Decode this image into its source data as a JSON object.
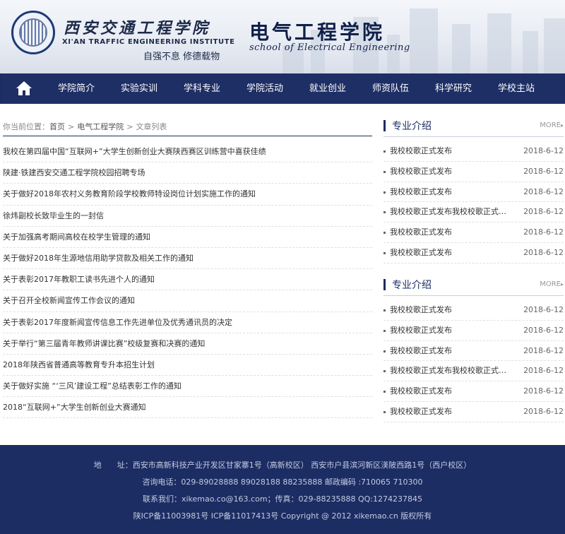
{
  "header": {
    "school_cn": "西安交通工程学院",
    "school_en": "XI'AN TRAFFIC ENGINEERING INSTITUTE",
    "motto": "自强不息 修德载物",
    "college_cn": "电气工程学院",
    "college_en": "school of Electrical Engineering"
  },
  "nav": {
    "home_icon": "home-icon",
    "items": [
      "学院简介",
      "实验实训",
      "学科专业",
      "学院活动",
      "就业创业",
      "师资队伍",
      "科学研究",
      "学校主站"
    ]
  },
  "breadcrumb": {
    "prefix": "你当前位置：",
    "items": [
      "首页",
      "电气工程学院",
      "文章列表"
    ],
    "sep": ">"
  },
  "articles": [
    "我校在第四届中国“互联网+”大学生创新创业大赛陕西赛区训练营中喜获佳绩",
    "陕建·铁建西安交通工程学院校园招聘专场",
    "关于做好2018年农村义务教育阶段学校教师特设岗位计划实施工作的通知",
    "徐炜副校长致毕业生的一封信",
    "关于加强高考期间高校在校学生管理的通知",
    "关于做好2018年生源地信用助学贷款及相关工作的通知",
    "关于表彰2017年教职工读书先进个人的通知",
    "关于召开全校新闻宣传工作会议的通知",
    "关于表彰2017年度新闻宣传信息工作先进单位及优秀通讯员的决定",
    "关于举行“第三届青年教师讲课比赛”校级复赛和决赛的通知",
    "2018年陕西省普通高等教育专升本招生计划",
    "关于做好实施 “‘三风’建设工程”总结表彰工作的通知",
    "2018“互联网+”大学生创新创业大赛通知"
  ],
  "sidebar": [
    {
      "title": "专业介绍",
      "more": "MORE",
      "items": [
        {
          "title": "我校校歌正式发布",
          "date": "2018-6-12"
        },
        {
          "title": "我校校歌正式发布",
          "date": "2018-6-12"
        },
        {
          "title": "我校校歌正式发布",
          "date": "2018-6-12"
        },
        {
          "title": "我校校歌正式发布我校校歌正式发布",
          "date": "2018-6-12"
        },
        {
          "title": "我校校歌正式发布",
          "date": "2018-6-12"
        },
        {
          "title": "我校校歌正式发布",
          "date": "2018-6-12"
        }
      ]
    },
    {
      "title": "专业介绍",
      "more": "MORE",
      "items": [
        {
          "title": "我校校歌正式发布",
          "date": "2018-6-12"
        },
        {
          "title": "我校校歌正式发布",
          "date": "2018-6-12"
        },
        {
          "title": "我校校歌正式发布",
          "date": "2018-6-12"
        },
        {
          "title": "我校校歌正式发布我校校歌正式发布",
          "date": "2018-6-12"
        },
        {
          "title": "我校校歌正式发布",
          "date": "2018-6-12"
        },
        {
          "title": "我校校歌正式发布",
          "date": "2018-6-12"
        }
      ]
    }
  ],
  "footer": {
    "address": "地　　址：西安市高新科技产业开发区甘家寨1号（高新校区） 西安市户县滨河新区渼陂西路1号（西户校区）",
    "phone": "咨询电话：029-89028888 89028188 88235888 邮政编码 :710065 710300",
    "contact": "联系我们：xikemao.co@163.com；传真：029-88235888 QQ:1274237845",
    "copyright": "陕ICP备11003981号 ICP备11017413号 Copyright @ 2012 xikemao.cn 版权所有"
  },
  "colors": {
    "nav_bg": "#1e2f66",
    "footer_bg": "#1c2d63",
    "accent": "#1c2d63"
  }
}
